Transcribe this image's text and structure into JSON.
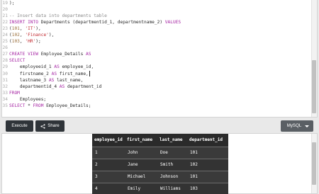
{
  "editor": {
    "lines": [
      {
        "n": "19",
        "parts": [
          {
            "t": ");",
            "c": "id"
          }
        ]
      },
      {
        "n": "20",
        "parts": []
      },
      {
        "n": "21",
        "parts": [
          {
            "t": "-- Insert data into departments table",
            "c": "cmt"
          }
        ]
      },
      {
        "n": "22",
        "parts": [
          {
            "t": "INSERT INTO",
            "c": "kw"
          },
          {
            "t": " Departments (departmentid_1, departmentname_2) ",
            "c": "id"
          },
          {
            "t": "VALUES",
            "c": "kw"
          }
        ]
      },
      {
        "n": "23",
        "parts": [
          {
            "t": "(",
            "c": "id"
          },
          {
            "t": "101",
            "c": "num"
          },
          {
            "t": ", ",
            "c": "id"
          },
          {
            "t": "'IT'",
            "c": "str"
          },
          {
            "t": "),",
            "c": "id"
          }
        ]
      },
      {
        "n": "24",
        "parts": [
          {
            "t": "(",
            "c": "id"
          },
          {
            "t": "102",
            "c": "num"
          },
          {
            "t": ", ",
            "c": "id"
          },
          {
            "t": "'Finance'",
            "c": "str"
          },
          {
            "t": "),",
            "c": "id"
          }
        ]
      },
      {
        "n": "25",
        "parts": [
          {
            "t": "(",
            "c": "id"
          },
          {
            "t": "103",
            "c": "num"
          },
          {
            "t": ", ",
            "c": "id"
          },
          {
            "t": "'HR'",
            "c": "str"
          },
          {
            "t": ");",
            "c": "id"
          }
        ]
      },
      {
        "n": "26",
        "parts": []
      },
      {
        "n": "27",
        "parts": [
          {
            "t": "CREATE VIEW",
            "c": "kw"
          },
          {
            "t": " Employee_Details ",
            "c": "id"
          },
          {
            "t": "AS",
            "c": "kw"
          }
        ]
      },
      {
        "n": "28",
        "parts": [
          {
            "t": "SELECT",
            "c": "kw"
          }
        ]
      },
      {
        "n": "29",
        "parts": [
          {
            "t": "    employeeid_1 ",
            "c": "id"
          },
          {
            "t": "AS",
            "c": "kw"
          },
          {
            "t": " employee_id,",
            "c": "id"
          }
        ]
      },
      {
        "n": "30",
        "parts": [
          {
            "t": "    firstname_2 ",
            "c": "id"
          },
          {
            "t": "AS",
            "c": "kw"
          },
          {
            "t": " first_name,",
            "c": "id"
          }
        ],
        "caret": true
      },
      {
        "n": "31",
        "parts": [
          {
            "t": "    lastname_3 ",
            "c": "id"
          },
          {
            "t": "AS",
            "c": "kw"
          },
          {
            "t": " last_name,",
            "c": "id"
          }
        ]
      },
      {
        "n": "32",
        "parts": [
          {
            "t": "    departmentid_4 ",
            "c": "id"
          },
          {
            "t": "AS",
            "c": "kw"
          },
          {
            "t": " department_id",
            "c": "id"
          }
        ]
      },
      {
        "n": "33",
        "parts": [
          {
            "t": "FROM",
            "c": "kw"
          }
        ]
      },
      {
        "n": "34",
        "parts": [
          {
            "t": "    Employees;",
            "c": "id"
          }
        ]
      },
      {
        "n": "35",
        "parts": [
          {
            "t": "SELECT",
            "c": "kw"
          },
          {
            "t": " * ",
            "c": "id"
          },
          {
            "t": "FROM",
            "c": "kw"
          },
          {
            "t": " Employee_Details;",
            "c": "id"
          }
        ]
      }
    ]
  },
  "toolbar": {
    "run_label": "Execute",
    "share_label": "Share",
    "db_label": "MySQL"
  },
  "results": {
    "columns": [
      "employee_id",
      "first_name",
      "last_name",
      "department_id"
    ],
    "rows": [
      [
        "1",
        "John",
        "Doe",
        "101"
      ],
      [
        "2",
        "Jane",
        "Smith",
        "102"
      ],
      [
        "3",
        "Michael",
        "Johnson",
        "101"
      ],
      [
        "4",
        "Emily",
        "Williams",
        "103"
      ]
    ]
  }
}
